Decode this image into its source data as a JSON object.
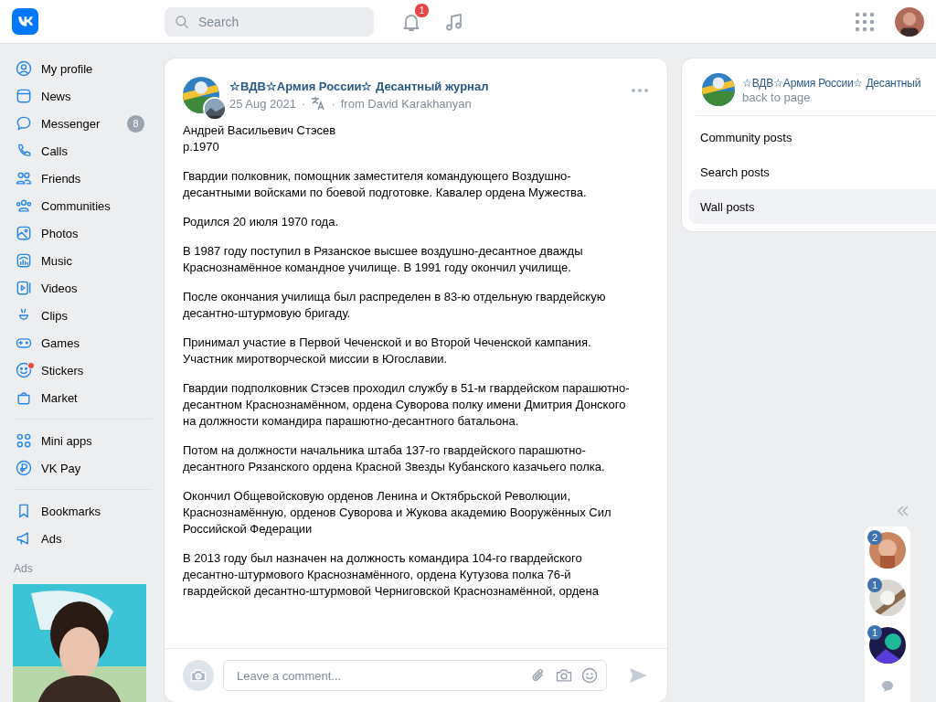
{
  "header": {
    "search": {
      "placeholder": "Search"
    },
    "notification_count": "1"
  },
  "sidebar": {
    "groups": [
      [
        {
          "label": "My profile"
        },
        {
          "label": "News"
        },
        {
          "label": "Messenger",
          "badge": "8"
        },
        {
          "label": "Calls"
        },
        {
          "label": "Friends"
        },
        {
          "label": "Communities"
        },
        {
          "label": "Photos"
        },
        {
          "label": "Music"
        },
        {
          "label": "Videos"
        },
        {
          "label": "Clips"
        },
        {
          "label": "Games"
        },
        {
          "label": "Stickers",
          "unread_dot": true
        },
        {
          "label": "Market"
        }
      ],
      [
        {
          "label": "Mini apps"
        },
        {
          "label": "VK Pay"
        }
      ],
      [
        {
          "label": "Bookmarks"
        },
        {
          "label": "Ads"
        }
      ]
    ],
    "ads_label": "Ads",
    "ad": {
      "kind": "picture"
    }
  },
  "post": {
    "author": "☆ВДВ☆Армия России☆ Десантный журнал",
    "date": "25 Aug 2021",
    "source": "from David Karakhanyan",
    "separators": [
      "·",
      "·"
    ],
    "paragraphs": [
      [
        "Андрей Васильевич Стэсев",
        "р.1970"
      ],
      [
        "Гвардии полковник, помощник заместителя командующего Воздушно-",
        "десантными войсками по боевой подготовке. Кавалер ордена Мужества."
      ],
      [
        "Родился 20 июля 1970 года."
      ],
      [
        "В 1987 году поступил в Рязанское высшее воздушно-десантное дважды",
        "Краснознамённое командное училище. В 1991 году окончил училище."
      ],
      [
        "После окончания училища был распределен в 83-ю отдельную гвардейскую",
        "десантно-штурмовую бригаду."
      ],
      [
        "Принимал участие в Первой Чеченской и во Второй Чеченской кампания.",
        "Участник миротворческой миссии в Югославии."
      ],
      [
        "Гвардии подполковник Стэсев проходил службу в 51-м гвардейском парашютно-",
        "десантном Краснознамённом, ордена Суворова полку имени Дмитрия Донского",
        "на должности командира парашютно-десантного батальона."
      ],
      [
        "Потом на должности начальника штаба 137-го гвардейского парашютно-",
        "десантного Рязанского ордена Красной Звезды Кубанского казачьего полка."
      ],
      [
        "Окончил Общевойсковую орденов Ленина и Октябрьской Революции,",
        "Краснознамённую, орденов Суворова и Жукова академию Вооружённых Сил",
        "Российской Федерации"
      ],
      [
        "В 2013 году был назначен на должность командира 104-го гвардейского",
        "десантно-штурмового Краснознамённого, ордена Кутузова полка 76-й",
        "гвардейской десантно-штурмовой Черниговской Краснознамённой, ордена"
      ]
    ],
    "comment": {
      "placeholder": "Leave a comment..."
    }
  },
  "side_panel": {
    "title": "☆ВДВ☆Армия России☆ Десантный",
    "back_link": "back to page",
    "items": [
      {
        "label": "Community posts",
        "selected": false
      },
      {
        "label": "Search posts",
        "selected": false
      },
      {
        "label": "Wall posts",
        "selected": true
      }
    ]
  },
  "chats": [
    {
      "count": "2"
    },
    {
      "count": "1"
    },
    {
      "count": "1"
    }
  ]
}
